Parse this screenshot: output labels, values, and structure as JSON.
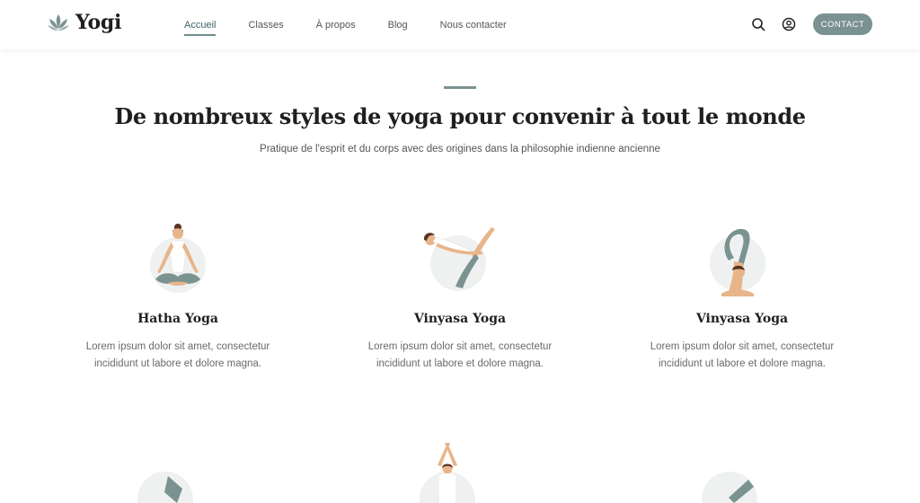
{
  "brand": {
    "name": "Yogi",
    "logo_icon": "lotus-icon"
  },
  "nav": {
    "items": [
      {
        "label": "Accueil",
        "active": true
      },
      {
        "label": "Classes",
        "active": false
      },
      {
        "label": "À propos",
        "active": false
      },
      {
        "label": "Blog",
        "active": false
      },
      {
        "label": "Nous contacter",
        "active": false
      }
    ],
    "search_icon": "search-icon",
    "account_icon": "user-circle-icon",
    "contact_label": "CONTACT"
  },
  "section": {
    "title": "De nombreux styles de yoga pour convenir à tout le monde",
    "subtitle": "Pratique de l'esprit et du corps avec des origines dans la philosophie indienne ancienne"
  },
  "cards": [
    {
      "title": "Hatha Yoga",
      "desc_line1": "Lorem ipsum dolor sit amet, consectetur",
      "desc_line2": "incididunt ut labore et dolore magna.",
      "icon": "meditation-pose-icon"
    },
    {
      "title": "Vinyasa Yoga",
      "desc_line1": "Lorem ipsum dolor sit amet, consectetur",
      "desc_line2": "incididunt ut labore et dolore magna.",
      "icon": "boat-pose-icon"
    },
    {
      "title": "Vinyasa Yoga",
      "desc_line1": "Lorem ipsum dolor sit amet, consectetur",
      "desc_line2": "incididunt ut labore et dolore magna.",
      "icon": "scorpion-pose-icon"
    }
  ],
  "colors": {
    "accent": "#7a9290",
    "skin": "#e8b48a",
    "pants": "#7a9290",
    "hair": "#5a3322",
    "circle": "#eef1f0"
  }
}
